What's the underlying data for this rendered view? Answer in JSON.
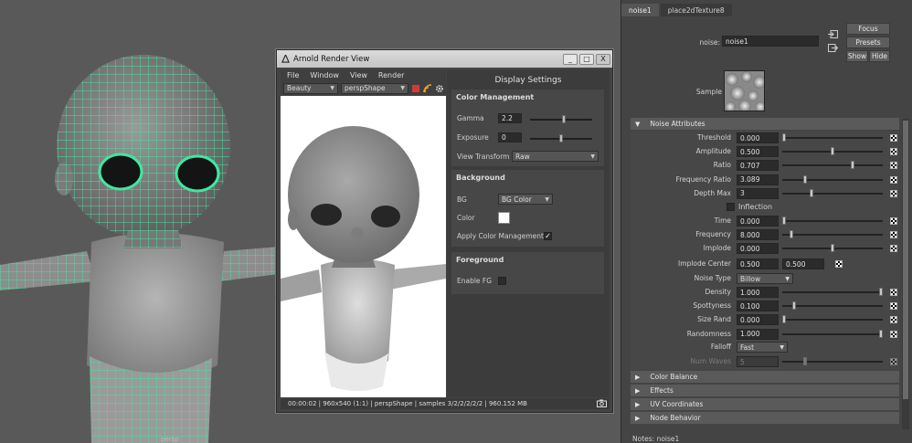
{
  "viewport": {
    "camera_label": "persp"
  },
  "render_view": {
    "title": "Arnold Render View",
    "window_buttons": [
      "_",
      "□",
      "X"
    ],
    "menu": [
      "File",
      "Window",
      "View",
      "Render"
    ],
    "aov_dropdown": "Beauty",
    "camera_dropdown": "perspShape",
    "status": "00:00:02 | 960x540 (1:1) | perspShape  | samples 3/2/2/2/2/2 | 960.152 MB",
    "display_settings": {
      "title": "Display Settings",
      "color_management": {
        "heading": "Color Management",
        "gamma_label": "Gamma",
        "gamma_value": "2.2",
        "gamma_level": 0.55,
        "exposure_label": "Exposure",
        "exposure_value": "0",
        "exposure_level": 0.5,
        "view_transform_label": "View Transform",
        "view_transform_value": "Raw"
      },
      "background": {
        "heading": "Background",
        "bg_label": "BG",
        "bg_value": "BG Color",
        "color_label": "Color",
        "color_value": "#ffffff",
        "apply_label": "Apply Color Management",
        "apply_checked": true
      },
      "foreground": {
        "heading": "Foreground",
        "enable_fg_label": "Enable FG",
        "enable_fg_checked": false
      }
    }
  },
  "attribute_editor": {
    "tabs": [
      "noise1",
      "place2dTexture8"
    ],
    "active_tab": 0,
    "noise_label": "noise:",
    "noise_name": "noise1",
    "buttons": {
      "focus": "Focus",
      "presets": "Presets",
      "show": "Show",
      "hide": "Hide"
    },
    "sample_label": "Sample",
    "noise_attributes": {
      "heading": "Noise Attributes",
      "rows": [
        {
          "label": "Threshold",
          "value": "0.000",
          "level": 0.0
        },
        {
          "label": "Amplitude",
          "value": "0.500",
          "level": 0.5
        },
        {
          "label": "Ratio",
          "value": "0.707",
          "level": 0.707
        },
        {
          "label": "Frequency Ratio",
          "value": "3.089",
          "level": 0.22
        },
        {
          "label": "Depth Max",
          "value": "3",
          "level": 0.28
        }
      ],
      "inflection_label": "Inflection",
      "time_rows": [
        {
          "label": "Time",
          "value": "0.000",
          "level": 0.0
        },
        {
          "label": "Frequency",
          "value": "8.000",
          "level": 0.08
        },
        {
          "label": "Implode",
          "value": "0.000",
          "level": 0.5
        }
      ],
      "implode_center_label": "Implode Center",
      "implode_center_values": [
        "0.500",
        "0.500"
      ],
      "noise_type_label": "Noise Type",
      "noise_type_value": "Billow",
      "billow_rows": [
        {
          "label": "Density",
          "value": "1.000",
          "level": 1.0
        },
        {
          "label": "Spottyness",
          "value": "0.100",
          "level": 0.1
        },
        {
          "label": "Size Rand",
          "value": "0.000",
          "level": 0.0
        },
        {
          "label": "Randomness",
          "value": "1.000",
          "level": 1.0
        }
      ],
      "falloff_label": "Falloff",
      "falloff_value": "Fast",
      "num_waves_label": "Num Waves",
      "num_waves_value": "5",
      "num_waves_level": 0.22
    },
    "collapsed_sections": [
      "Color Balance",
      "Effects",
      "UV Coordinates",
      "Node Behavior"
    ],
    "notes": "Notes:  noise1"
  }
}
